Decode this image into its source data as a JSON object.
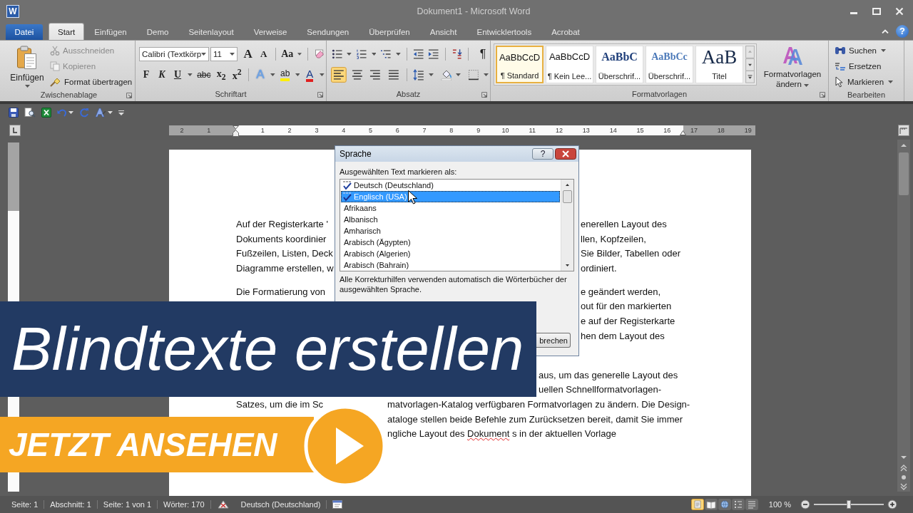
{
  "window": {
    "icon_letter": "W",
    "title": "Dokument1 - Microsoft Word"
  },
  "tabs": [
    {
      "label": "Datei",
      "kind": "file",
      "selected": false
    },
    {
      "label": "Start",
      "kind": "tab",
      "selected": true
    },
    {
      "label": "Einfügen",
      "kind": "tab",
      "selected": false
    },
    {
      "label": "Demo",
      "kind": "tab",
      "selected": false
    },
    {
      "label": "Seitenlayout",
      "kind": "tab",
      "selected": false
    },
    {
      "label": "Verweise",
      "kind": "tab",
      "selected": false
    },
    {
      "label": "Sendungen",
      "kind": "tab",
      "selected": false
    },
    {
      "label": "Überprüfen",
      "kind": "tab",
      "selected": false
    },
    {
      "label": "Ansicht",
      "kind": "tab",
      "selected": false
    },
    {
      "label": "Entwicklertools",
      "kind": "tab",
      "selected": false
    },
    {
      "label": "Acrobat",
      "kind": "tab",
      "selected": false
    }
  ],
  "ribbon_help": "?",
  "ribbon": {
    "clipboard": {
      "label": "Zwischenablage",
      "paste": "Einfügen",
      "items": [
        {
          "label": "Ausschneiden",
          "kind": "cut",
          "disabled": true
        },
        {
          "label": "Kopieren",
          "kind": "copy",
          "disabled": true
        },
        {
          "label": "Format übertragen",
          "kind": "painter",
          "disabled": false
        }
      ]
    },
    "font": {
      "label": "Schriftart",
      "font_name": "Calibri (Textkörp",
      "font_size": "11",
      "row_1": [
        {
          "kind": "grow",
          "text": "A"
        },
        {
          "kind": "shrink",
          "text": "A"
        },
        {
          "kind": "case",
          "text": "Aa"
        }
      ],
      "row_2": [
        {
          "kind": "bold",
          "text": "F"
        },
        {
          "kind": "italic",
          "text": "K"
        },
        {
          "kind": "underline",
          "text": "U"
        },
        {
          "kind": "strike",
          "text": "abc"
        },
        {
          "kind": "sub",
          "text": "x$_{2}$"
        },
        {
          "kind": "sup",
          "text": "x$^{2}$"
        },
        {
          "kind": "effects",
          "text": "A"
        },
        {
          "kind": "highlight",
          "text": "ab"
        },
        {
          "kind": "color",
          "text": "A"
        }
      ]
    },
    "paragraph": {
      "label": "Absatz",
      "pilcrow": "¶",
      "alignment": [
        {
          "kind": "left",
          "selected": true
        },
        {
          "kind": "center",
          "selected": false
        },
        {
          "kind": "right",
          "selected": false
        },
        {
          "kind": "justify",
          "selected": false
        }
      ]
    },
    "styles": {
      "label": "Formatvorlagen",
      "gallery": [
        {
          "preview": "AaBbCcD",
          "label": "¶ Standard",
          "kind": "normal",
          "selected": true
        },
        {
          "preview": "AaBbCcD",
          "label": "¶ Kein Lee...",
          "kind": "normal",
          "selected": false
        },
        {
          "preview": "AaBbC",
          "label": "Überschrif...",
          "kind": "heading1",
          "selected": false
        },
        {
          "preview": "AaBbCc",
          "label": "Überschrif...",
          "kind": "heading2",
          "selected": false
        },
        {
          "preview": "AaB",
          "label": "Titel",
          "kind": "title",
          "selected": false
        }
      ],
      "change_styles": "Formatvorlagen ändern"
    },
    "editing": {
      "label": "Bearbeiten",
      "items": [
        {
          "label": "Suchen",
          "kind": "find"
        },
        {
          "label": "Ersetzen",
          "kind": "replace"
        },
        {
          "label": "Markieren",
          "kind": "select"
        }
      ]
    }
  },
  "ruler": {
    "left_labels": [
      "2",
      "1"
    ],
    "labels": [
      "1",
      "2",
      "3",
      "4",
      "5",
      "6",
      "7",
      "8",
      "9",
      "10",
      "11",
      "12",
      "13",
      "14",
      "15",
      "16",
      "17",
      "18",
      "19"
    ]
  },
  "document": {
    "paragraphs": [
      {
        "lines": [
          {
            "kind": "split-dialog",
            "left": "Auf der Registerkarte '",
            "right": [
              {
                "text": "enerellen Layout des",
                "misspelled": false
              }
            ]
          },
          {
            "kind": "split-dialog",
            "left": "Dokuments koordinier",
            "right": [
              {
                "text": "llen, Kopfzeilen,",
                "misspelled": false
              }
            ]
          },
          {
            "kind": "split-dialog",
            "left": "Fußzeilen, Listen, Deck",
            "right": [
              {
                "text": "Sie Bilder, Tabellen oder",
                "misspelled": false
              }
            ]
          },
          {
            "kind": "split-dialog",
            "left": "Diagramme erstellen, w",
            "right": [
              {
                "text": "ordiniert.",
                "misspelled": false
              }
            ]
          }
        ]
      },
      {
        "lines": [
          {
            "kind": "split-dialog",
            "left": "Die Formatierung von",
            "right": [
              {
                "text": "e geändert werden,",
                "misspelled": false
              }
            ]
          },
          {
            "kind": "split-dialog",
            "right": [
              {
                "text": "out für den markierten",
                "misspelled": false
              }
            ]
          },
          {
            "kind": "split-dialog",
            "right": [
              {
                "text": "e auf der Registerkarte",
                "misspelled": false
              }
            ]
          },
          {
            "kind": "split-dialog",
            "right": [
              {
                "text": "hen dem Layout des",
                "misspelled": false
              }
            ]
          }
        ]
      },
      {
        "lines": [
          {
            "kind": "split-banner",
            "right": [
              {
                "text": "aus, um das generelle Layout des",
                "misspelled": false
              }
            ]
          },
          {
            "kind": "split-banner",
            "right": [
              {
                "text": "uellen Schnellformatvorlagen-",
                "misspelled": false
              }
            ]
          },
          {
            "kind": "split-button",
            "left": "Satzes, um die im Sc",
            "right": [
              {
                "text": "matvorlagen-Katalog verfügbaren Formatvorlagen zu ändern. Die Design-",
                "misspelled": false
              }
            ]
          },
          {
            "kind": "split-button",
            "right": [
              {
                "text": "ataloge stellen beide Befehle zum Zurücksetzen bereit, damit Sie immer",
                "misspelled": false
              }
            ]
          },
          {
            "kind": "split-button",
            "right": [
              {
                "text": "ngliche Layout des ",
                "misspelled": false
              },
              {
                "text": "Dokument",
                "misspelled": true
              },
              {
                "text": " s in der aktuellen Vorlage",
                "misspelled": false
              }
            ]
          }
        ]
      }
    ]
  },
  "dialog": {
    "title": "Sprache",
    "help": "?",
    "prompt": "Ausgewählten Text markieren als:",
    "languages": [
      {
        "label": "Deutsch (Deutschland)",
        "proofing": true,
        "selected": false
      },
      {
        "label": "Englisch (USA)",
        "proofing": true,
        "selected": true
      },
      {
        "label": "Afrikaans",
        "proofing": false,
        "selected": false
      },
      {
        "label": "Albanisch",
        "proofing": false,
        "selected": false
      },
      {
        "label": "Amharisch",
        "proofing": false,
        "selected": false
      },
      {
        "label": "Arabisch (Ägypten)",
        "proofing": false,
        "selected": false
      },
      {
        "label": "Arabisch (Algerien)",
        "proofing": false,
        "selected": false
      },
      {
        "label": "Arabisch (Bahrain)",
        "proofing": false,
        "selected": false
      }
    ],
    "note": "Alle Korrekturhilfen verwenden automatisch die Wörterbücher der ausgewählten Sprache.",
    "cancel": "brechen"
  },
  "promo": {
    "title": "Blindtexte erstellen",
    "cta": "JETZT ANSEHEN"
  },
  "status_bar": {
    "items": [
      "Seite: 1",
      "Abschnitt: 1",
      "Seite: 1 von 1",
      "Wörter: 170"
    ],
    "language": "Deutsch (Deutschland)",
    "views": [
      {
        "selected": true
      },
      {
        "selected": false
      },
      {
        "selected": false
      },
      {
        "selected": false
      },
      {
        "selected": false
      }
    ],
    "zoom": "100 %",
    "zoom_slider": {
      "level": 0.5
    }
  }
}
